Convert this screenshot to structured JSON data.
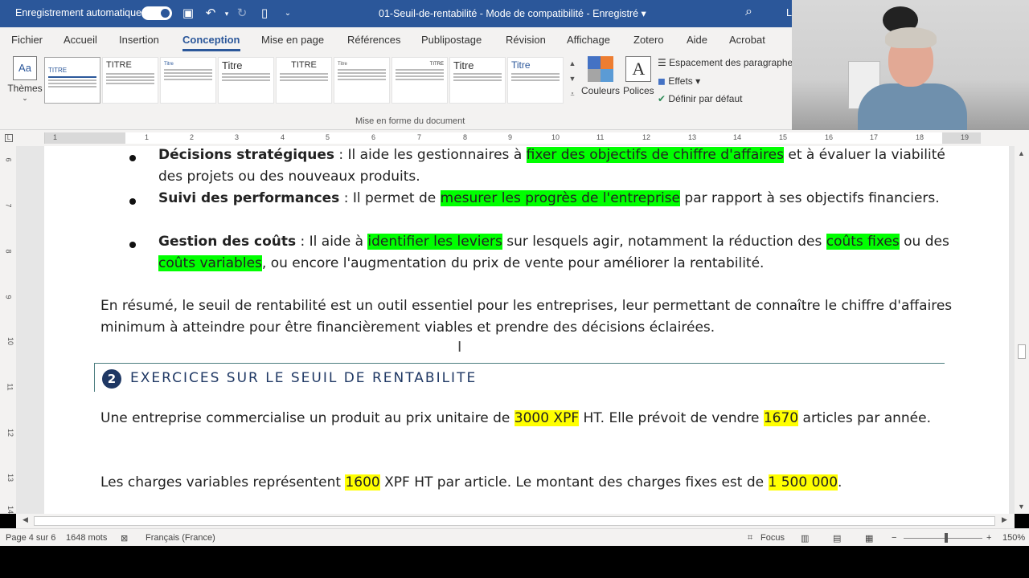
{
  "titlebar": {
    "autosave_label": "Enregistrement automatique",
    "autosave_toggle": "Activé",
    "autosave_state_text": "",
    "document_title": "01-Seuil-de-rentabilité  -  Mode de compatibilité  -  Enregistré ▾",
    "user_initial": "L"
  },
  "tabs": [
    "Fichier",
    "Accueil",
    "Insertion",
    "Conception",
    "Mise en page",
    "Références",
    "Publipostage",
    "Révision",
    "Affichage",
    "Zotero",
    "Aide",
    "Acrobat"
  ],
  "active_tab": "Conception",
  "ribbon": {
    "themes_label": "Thèmes",
    "themes_icon_text": "Aa",
    "gallery_titles": [
      "TITRE",
      "TITRE",
      "Titre",
      "Titre",
      "TITRE",
      "Titre",
      "TITRE",
      "Titre",
      "Titre"
    ],
    "couleurs_label": "Couleurs",
    "polices_label": "Polices",
    "polices_icon_text": "A",
    "espacement_label": "Espacement des paragraphes",
    "effets_label": "Effets ▾",
    "definir_label": "Définir par défaut",
    "group_label": "Mise en forme du document",
    "accent_colors": [
      "#4472c4",
      "#ed7d31",
      "#a5a5a5",
      "#5b9bd5"
    ]
  },
  "ruler": {
    "ticks": [
      "1",
      "1",
      "2",
      "3",
      "4",
      "5",
      "6",
      "7",
      "8",
      "9",
      "10",
      "11",
      "12",
      "13",
      "14",
      "15",
      "16",
      "17",
      "18",
      "19"
    ],
    "vticks": [
      "6",
      "7",
      "8",
      "9",
      "10",
      "11",
      "12",
      "13",
      "14"
    ]
  },
  "document": {
    "bullets": [
      {
        "bold": "Décisions stratégiques",
        "pre": " : Il aide les gestionnaires à ",
        "hl": "fixer des objectifs de chiffre d'affaires",
        "post": " et à évaluer la viabilité des projets ou des nouveaux produits."
      },
      {
        "bold": "Suivi des performances",
        "pre": " : Il permet de ",
        "hl": "mesurer les progrès de l'entreprise",
        "post": " par rapport à ses objectifs financiers."
      },
      {
        "bold": "Gestion des coûts",
        "pre": " : Il aide à ",
        "hl": "identifier les leviers",
        "mid": " sur lesquels agir, notamment la réduction des ",
        "hl2": "coûts fixes",
        "mid2": " ou des ",
        "hl3": "coûts variables",
        "post": ", ou encore l'augmentation du prix de vente pour améliorer la rentabilité."
      }
    ],
    "summary": "En résumé, le seuil de rentabilité est un outil essentiel pour les entreprises, leur permettant de connaître le chiffre d'affaires minimum à atteindre pour être financièrement viables et prendre des décisions éclairées.",
    "heading_number": "2",
    "heading_text": "EXERCICES SUR LE SEUIL DE RENTABILITE",
    "exercise": {
      "p1_a": "Une entreprise commercialise un produit au prix unitaire de ",
      "p1_price": "3000 XPF",
      "p1_b": " HT. Elle prévoit de vendre ",
      "p1_qty": "1670",
      "p1_c": " articles par année.",
      "p2_a": "Les charges variables représentent ",
      "p2_cv": "1600",
      "p2_b": " XPF HT par article. Le montant des charges fixes est de ",
      "p2_cf": "1 500 000",
      "p2_c": "."
    }
  },
  "statusbar": {
    "page": "Page 4 sur 6",
    "words": "1648 mots",
    "language": "Français (France)",
    "focus": "Focus",
    "zoom": "150%"
  },
  "colors": {
    "brand": "#2b579a",
    "highlight_green": "#00ff00",
    "highlight_yellow": "#ffff00",
    "heading": "#1f3864"
  }
}
